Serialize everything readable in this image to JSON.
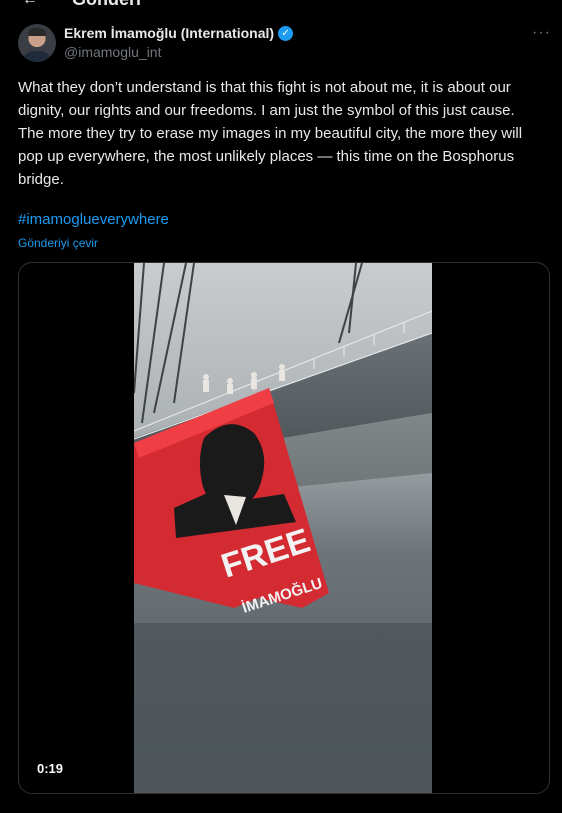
{
  "header": {
    "back_icon": "arrow-left-icon",
    "title": "Gönderi"
  },
  "author": {
    "name": "Ekrem İmamoğlu (International)",
    "handle": "@imamoglu_int",
    "verified_icon": "verified-badge-icon",
    "more_icon": "more-dots-icon",
    "more_label": "···"
  },
  "tweet": {
    "text": "What they don’t understand is that this fight is not about me, it is about our dignity, our rights and our freedoms. I am just the symbol of this just cause. The more they try to erase my images in my beautiful city, the more they will pop up everywhere, the most unlikely places — this time on the Bosphorus bridge.",
    "hashtag": "#imamoglueverywhere",
    "translate_label": "Gönderiyi çevir"
  },
  "media": {
    "type": "video",
    "duration": "0:19",
    "banner_text_1": "FREE",
    "banner_text_2": "İMAMOĞLU"
  },
  "colors": {
    "accent": "#1d9bf0",
    "background": "#000000",
    "text": "#e7e9ea",
    "muted": "#71767b",
    "banner_red": "#d42a32"
  }
}
